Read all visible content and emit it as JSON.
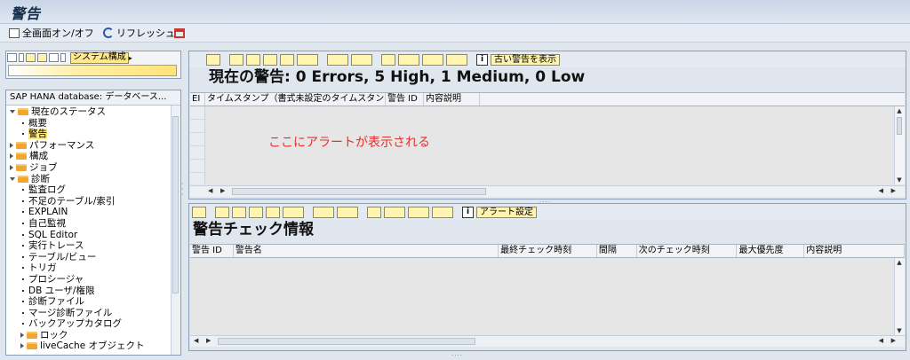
{
  "window": {
    "title": "警告"
  },
  "app_toolbar": {
    "fullscreen": "全画面オン/オフ",
    "refresh": "リフレッシュ"
  },
  "left": {
    "system_button": "システム構成",
    "tree_header": "SAP HANA database: データベース...",
    "tree": [
      {
        "label": "現在のステータス",
        "level": 0,
        "type": "folder",
        "expanded": true
      },
      {
        "label": "概要",
        "level": 1,
        "type": "leaf"
      },
      {
        "label": "警告",
        "level": 1,
        "type": "leaf",
        "selected": true
      },
      {
        "label": "パフォーマンス",
        "level": 0,
        "type": "folder",
        "expanded": false
      },
      {
        "label": "構成",
        "level": 0,
        "type": "folder",
        "expanded": false
      },
      {
        "label": "ジョブ",
        "level": 0,
        "type": "folder",
        "expanded": false
      },
      {
        "label": "診断",
        "level": 0,
        "type": "folder",
        "expanded": true
      },
      {
        "label": "監査ログ",
        "level": 1,
        "type": "leaf"
      },
      {
        "label": "不足のテーブル/索引",
        "level": 1,
        "type": "leaf"
      },
      {
        "label": "EXPLAIN",
        "level": 1,
        "type": "leaf"
      },
      {
        "label": "自己監視",
        "level": 1,
        "type": "leaf"
      },
      {
        "label": "SQL Editor",
        "level": 1,
        "type": "leaf"
      },
      {
        "label": "実行トレース",
        "level": 1,
        "type": "leaf"
      },
      {
        "label": "テーブル/ビュー",
        "level": 1,
        "type": "leaf"
      },
      {
        "label": "トリガ",
        "level": 1,
        "type": "leaf"
      },
      {
        "label": "プロシージャ",
        "level": 1,
        "type": "leaf"
      },
      {
        "label": "DB ユーザ/権限",
        "level": 1,
        "type": "leaf"
      },
      {
        "label": "診断ファイル",
        "level": 1,
        "type": "leaf"
      },
      {
        "label": "マージ診断ファイル",
        "level": 1,
        "type": "leaf"
      },
      {
        "label": "バックアップカタログ",
        "level": 1,
        "type": "leaf"
      },
      {
        "label": "ロック",
        "level": 1,
        "type": "folder",
        "expanded": false
      },
      {
        "label": "liveCache オブジェクト",
        "level": 1,
        "type": "folder",
        "expanded": false
      }
    ]
  },
  "current_alerts": {
    "toolbar_button": "古い警告を表示",
    "title": "現在の警告: 0 Errors, 5  High, 1  Medium, 0 Low",
    "columns": [
      "EI",
      "タイムスタンプ（書式未設定のタイムスタンプ）",
      "警告 ID",
      "内容説明"
    ],
    "message": "ここにアラートが表示される"
  },
  "alert_checks": {
    "toolbar_button": "アラート設定",
    "title": "警告チェック情報",
    "columns": [
      "警告 ID",
      "警告名",
      "最終チェック時刻",
      "間隔",
      "次のチェック時刻",
      "最大優先度",
      "内容説明"
    ]
  }
}
